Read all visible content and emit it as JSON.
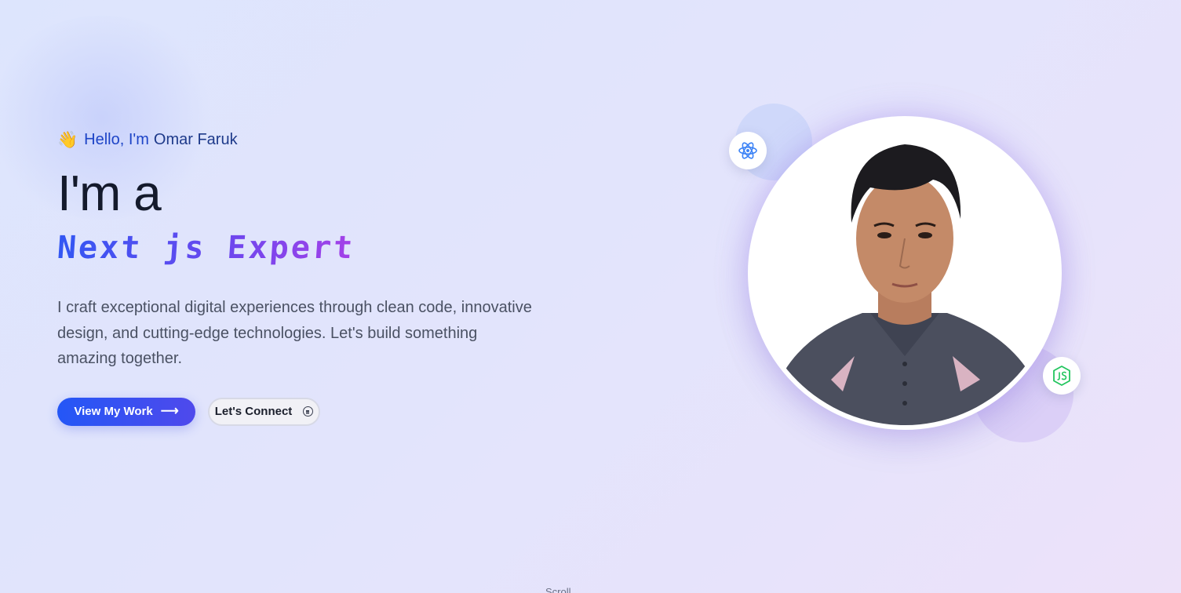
{
  "hero": {
    "greeting_wave": "👋",
    "greeting_prefix": "Hello, I'm",
    "greeting_name": "Omar Faruk",
    "headline": "I'm a",
    "role": "Next js Expert",
    "description": "I craft exceptional digital experiences through clean code, innovative design, and cutting-edge technologies. Let's build something amazing together.",
    "primary_button": "View My Work",
    "primary_icon": "arrow-right-icon",
    "secondary_button": "Let's Connect",
    "secondary_icon": "chat-bubble-icon"
  },
  "profile": {
    "image": "profile-photo",
    "badges": [
      "react-icon",
      "nodejs-icon"
    ]
  },
  "scroll_hint": "Scroll",
  "colors": {
    "accent_blue": "#2457f6",
    "accent_purple": "#a541e8",
    "heading": "#141a2c",
    "body_text": "#4a5163",
    "react": "#3b82f6",
    "nodejs": "#22c55e"
  }
}
